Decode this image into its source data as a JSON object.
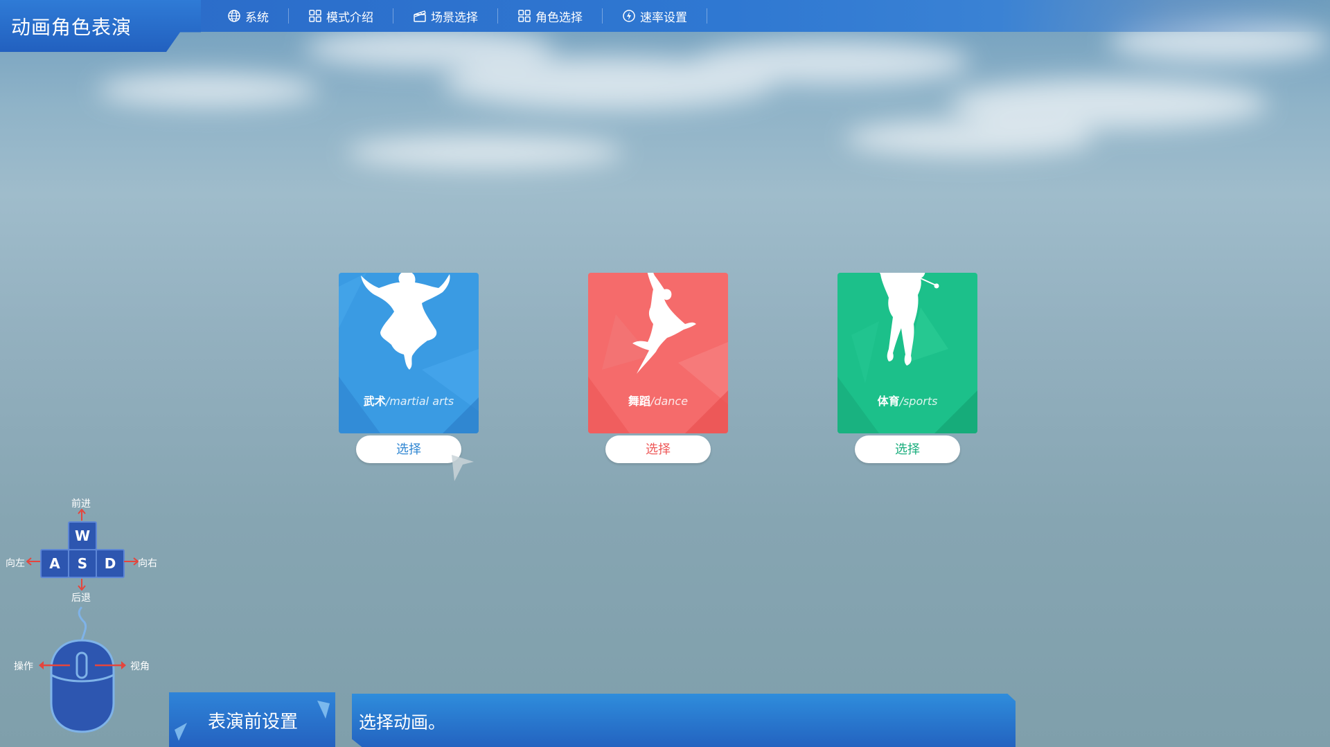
{
  "app": {
    "title": "动画角色表演"
  },
  "nav": {
    "items": [
      {
        "label": "系统",
        "icon": "globe-icon"
      },
      {
        "label": "模式介绍",
        "icon": "grid-icon"
      },
      {
        "label": "场景选择",
        "icon": "clapperboard-icon"
      },
      {
        "label": "角色选择",
        "icon": "grid-icon"
      },
      {
        "label": "速率设置",
        "icon": "lightning-icon"
      }
    ]
  },
  "cards": [
    {
      "cn": "武术",
      "en": "/martial arts",
      "button": "选择",
      "color": "#3a9be3",
      "accent": "#2f86d2"
    },
    {
      "cn": "舞蹈",
      "en": "/dance",
      "button": "选择",
      "color": "#f56b6b",
      "accent": "#ee5858"
    },
    {
      "cn": "体育",
      "en": "/sports",
      "button": "选择",
      "color": "#1cc08a",
      "accent": "#18ad7c"
    }
  ],
  "controls": {
    "keys": {
      "w": "W",
      "a": "A",
      "s": "S",
      "d": "D"
    },
    "labels": {
      "forward": "前进",
      "left": "向左",
      "right": "向右",
      "back": "后退",
      "operate": "操作",
      "view": "视角"
    }
  },
  "bottom": {
    "left_title": "表演前设置",
    "message": "选择动画。"
  },
  "colors": {
    "topbar": "#2a69c7",
    "panel": "#2363c0",
    "arrow": "#e5453d"
  }
}
